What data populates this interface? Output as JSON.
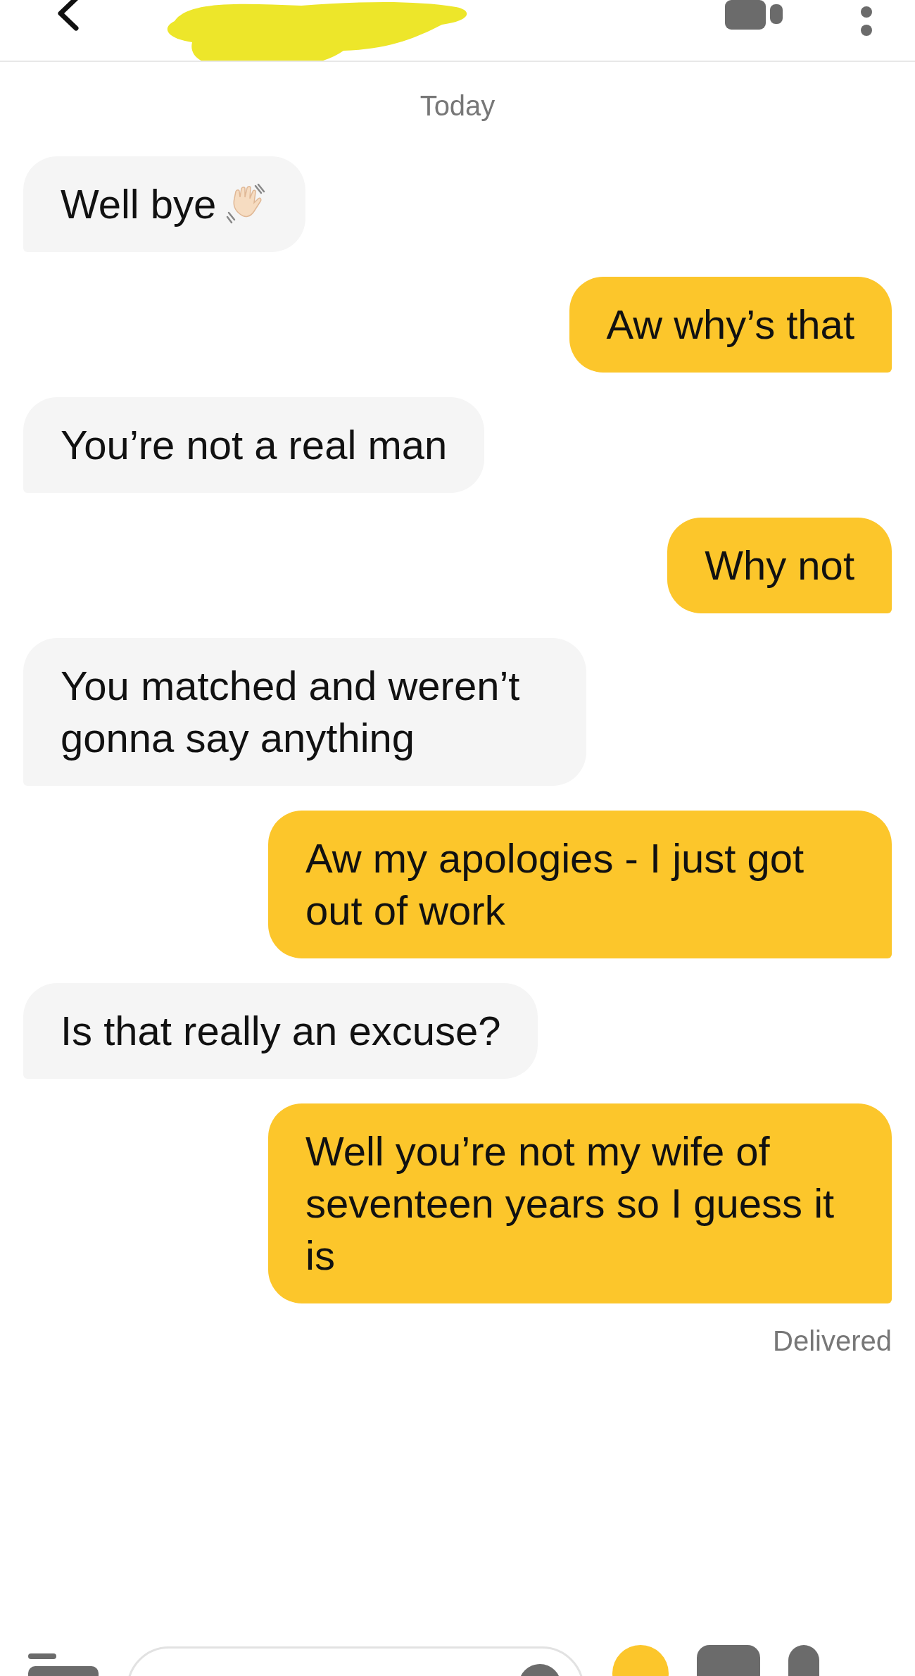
{
  "date_label": "Today",
  "messages": [
    {
      "kind": "incoming",
      "text": "Well bye",
      "wave_emoji": true
    },
    {
      "kind": "outgoing",
      "text": "Aw why’s that",
      "wave_emoji": false
    },
    {
      "kind": "incoming",
      "text": "You’re not a real man",
      "wave_emoji": false
    },
    {
      "kind": "outgoing",
      "text": "Why not",
      "wave_emoji": false
    },
    {
      "kind": "incoming",
      "text": "You matched and weren’t gonna say anything",
      "wave_emoji": false
    },
    {
      "kind": "outgoing",
      "text": "Aw my apologies - I just got out of work",
      "wave_emoji": false
    },
    {
      "kind": "incoming",
      "text": "Is that really an excuse?",
      "wave_emoji": false
    },
    {
      "kind": "outgoing",
      "text": "Well you’re not my wife of seventeen years so I guess it is",
      "wave_emoji": false
    }
  ],
  "status": "Delivered"
}
